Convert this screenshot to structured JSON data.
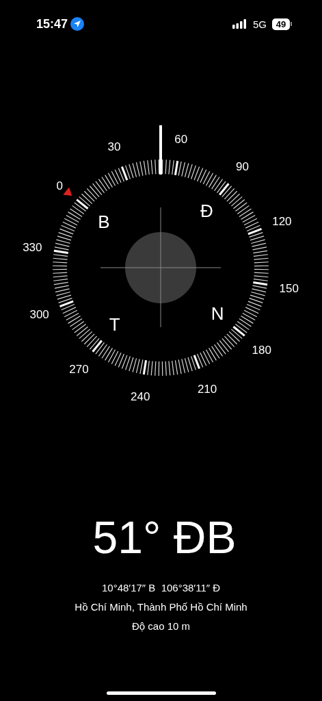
{
  "status_bar": {
    "time": "15:47",
    "network": "5G",
    "battery": "49"
  },
  "compass": {
    "degree_labels": [
      "0",
      "30",
      "60",
      "90",
      "120",
      "150",
      "180",
      "210",
      "240",
      "270",
      "300",
      "330"
    ],
    "cardinals": [
      "B",
      "Đ",
      "N",
      "T"
    ]
  },
  "heading": "51° ĐB",
  "coordinates": "10°48′17″ B  106°38′11″ Đ",
  "location": "Hồ Chí Minh, Thành Phố Hồ Chí Minh",
  "altitude": "Độ cao 10 m"
}
